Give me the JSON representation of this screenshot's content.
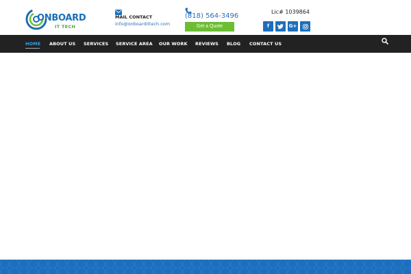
{
  "header": {
    "logo": {
      "word": "ONBOARD",
      "sub": "IT TECH",
      "icon": "onboard-logo-circle"
    },
    "mail": {
      "icon": "envelope-icon",
      "label": "MAIL CONTACT",
      "address": "info@onboardittech.com"
    },
    "phone": {
      "icon": "phone-icon",
      "number": "(818) 564-3496",
      "quote_button": "Get a Quote"
    },
    "license": "Lic# 1039864",
    "social": [
      {
        "icon": "facebook-icon",
        "glyph": "f"
      },
      {
        "icon": "twitter-icon",
        "glyph": "t"
      },
      {
        "icon": "google-plus-icon",
        "glyph": "G+"
      },
      {
        "icon": "instagram-icon",
        "glyph": "o"
      }
    ]
  },
  "nav": {
    "items": [
      {
        "label": "HOME",
        "active": true
      },
      {
        "label": "ABOUT US",
        "active": false
      },
      {
        "label": "SERVICES",
        "active": false
      },
      {
        "label": "SERVICE AREA",
        "active": false
      },
      {
        "label": "OUR WORK",
        "active": false
      },
      {
        "label": "REVIEWS",
        "active": false
      },
      {
        "label": "BLOG",
        "active": false
      },
      {
        "label": "CONTACT US",
        "active": false
      }
    ],
    "search_icon": "search-icon"
  },
  "colors": {
    "brand_blue": "#1d6fbb",
    "brand_green": "#6cbd33",
    "nav_bg": "#222222",
    "nav_active": "#3aa0e6",
    "footer_band": "#1c6fbc"
  }
}
